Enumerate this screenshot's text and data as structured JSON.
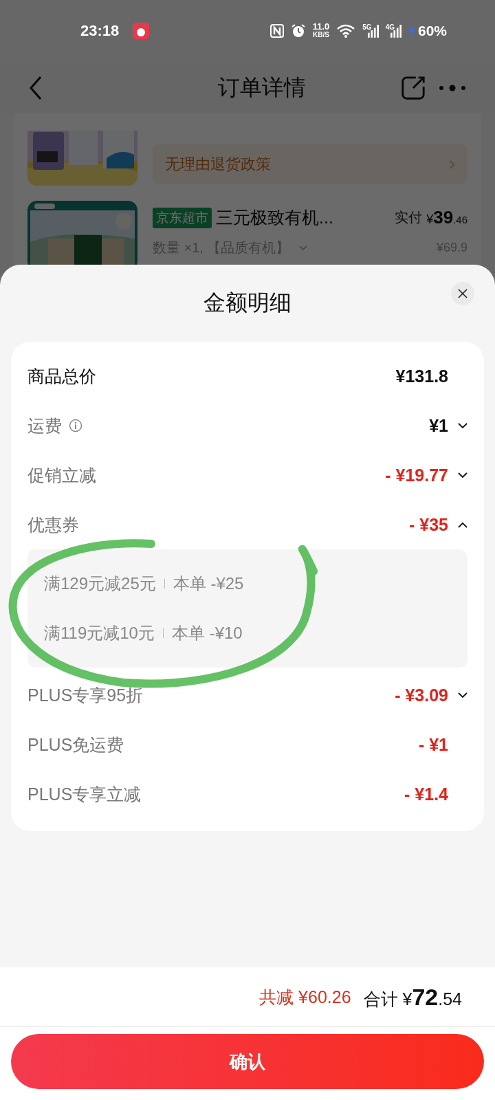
{
  "status_bar": {
    "time": "23:18",
    "network_speed": "11.0",
    "speed_unit": "KB/S",
    "signals": [
      {
        "label": "5G"
      },
      {
        "label": "4G"
      }
    ],
    "charging": true,
    "battery": "60%"
  },
  "header": {
    "title": "订单详情"
  },
  "order_items": [
    {
      "kind": "policy",
      "policy": "无理由退货政策"
    },
    {
      "kind": "product",
      "store_tag": "京东超市",
      "name": "三元极致有机...",
      "paid_label": "实付",
      "paid_price": "¥39.46",
      "spec": "数量 ×1, 【品质有机】",
      "original_price": "¥69.9"
    }
  ],
  "sheet": {
    "title": "金额明细",
    "rows": [
      {
        "kind": "total",
        "label": "商品总价",
        "value": "¥131.8"
      },
      {
        "kind": "fee",
        "label": "运费",
        "value": "¥1",
        "info": true,
        "expanded": false
      },
      {
        "kind": "discount",
        "label": "促销立减",
        "value": "- ¥19.77",
        "expanded": false
      },
      {
        "kind": "discount",
        "label": "优惠券",
        "value": "- ¥35",
        "expanded": true,
        "children": [
          {
            "condition": "满129元减25元",
            "amount": "本单 -¥25"
          },
          {
            "condition": "满119元减10元",
            "amount": "本单 -¥10"
          }
        ]
      },
      {
        "kind": "discount",
        "label": "PLUS专享95折",
        "value": "- ¥3.09",
        "expanded": false
      },
      {
        "kind": "discount",
        "label": "PLUS免运费",
        "value": "- ¥1"
      },
      {
        "kind": "discount",
        "label": "PLUS专享立减",
        "value": "- ¥1.4"
      }
    ],
    "markup": {
      "kind": "circle"
    }
  },
  "footer": {
    "savings_label": "共减",
    "savings": "¥60.26",
    "total_label": "合计",
    "total": "¥72.54",
    "button": "确认"
  }
}
